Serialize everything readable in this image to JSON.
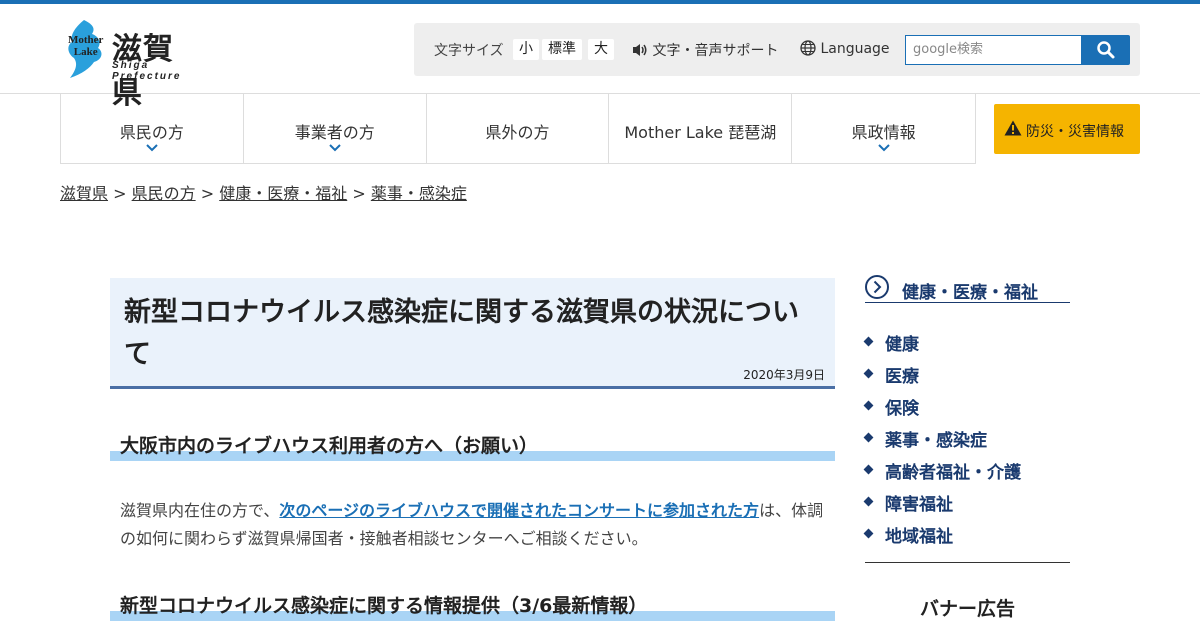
{
  "header": {
    "logo": {
      "name": "滋賀県",
      "sub": "Shiga Prefecture",
      "mark_text_1": "Mother",
      "mark_text_2": "Lake"
    },
    "font_size": {
      "label": "文字サイズ",
      "small": "小",
      "standard": "標準",
      "large": "大"
    },
    "support_label": "文字・音声サポート",
    "language_label": "Language",
    "search": {
      "placeholder": "google検索"
    }
  },
  "nav": {
    "items": [
      {
        "label": "県民の方",
        "has_dropdown": true
      },
      {
        "label": "事業者の方",
        "has_dropdown": true
      },
      {
        "label": "県外の方",
        "has_dropdown": false
      },
      {
        "label": "Mother Lake 琵琶湖",
        "has_dropdown": false
      },
      {
        "label": "県政情報",
        "has_dropdown": true
      }
    ],
    "disaster_label": "防災・災害情報"
  },
  "breadcrumb": {
    "items": [
      "滋賀県",
      "県民の方",
      "健康・医療・福祉",
      "薬事・感染症"
    ],
    "separator": ">"
  },
  "main": {
    "title": "新型コロナウイルス感染症に関する滋賀県の状況について",
    "date": "2020年3月9日",
    "section1": {
      "heading": "大阪市内のライブハウス利用者の方へ（お願い）",
      "text_before": "滋賀県内在住の方で、",
      "link": "次のページのライブハウスで開催されたコンサートに参加された方",
      "text_after": "は、体調の如何に関わらず滋賀県帰国者・接触者相談センターへご相談ください。"
    },
    "section2": {
      "heading": "新型コロナウイルス感染症に関する情報提供（3/6最新情報）"
    }
  },
  "sidebar": {
    "heading": "健康・医療・福祉",
    "items": [
      "健康",
      "医療",
      "保険",
      "薬事・感染症",
      "高齢者福祉・介護",
      "障害福祉",
      "地域福祉"
    ],
    "banner_title": "バナー広告"
  },
  "colors": {
    "brand_blue": "#1a6fb5",
    "navy": "#1a3a6e",
    "warning_yellow": "#f5b400",
    "heading_bar": "#a9d4f5"
  }
}
